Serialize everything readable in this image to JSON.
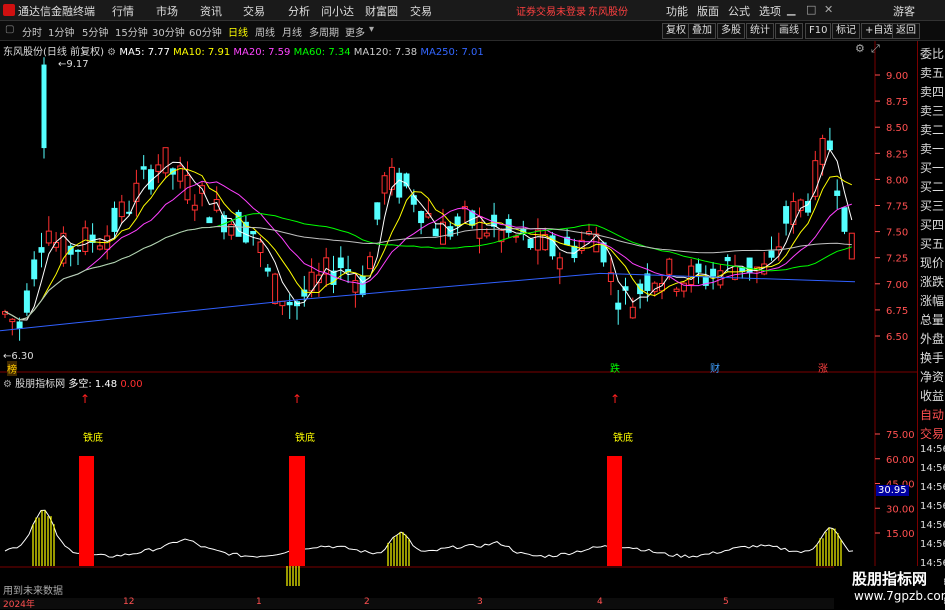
{
  "menubar": {
    "app_title": "通达信金融终端",
    "menus": [
      "行情",
      "市场",
      "资讯",
      "交易",
      "分析",
      "问小达",
      "财富圈",
      "交易"
    ],
    "notice": "证券交易未登录",
    "stock_short": "东风股份",
    "right_menus": [
      "功能",
      "版面",
      "公式",
      "选项"
    ],
    "user": "游客"
  },
  "periodbar": {
    "periods": [
      "分时",
      "1分钟",
      "5分钟",
      "15分钟",
      "30分钟",
      "60分钟",
      "日线",
      "周线",
      "月线",
      "多周期",
      "更多"
    ],
    "active": "日线",
    "right_buttons": [
      "复权",
      "叠加",
      "多股",
      "统计",
      "画线",
      "F10",
      "标记",
      "+自选",
      "返回"
    ]
  },
  "main_chart": {
    "title": "东风股份(日线 前复权)",
    "ma": [
      {
        "label": "MA5: 7.77",
        "color": "#ffffff"
      },
      {
        "label": "MA10: 7.91",
        "color": "#ffff00"
      },
      {
        "label": "MA20: 7.59",
        "color": "#ff40ff"
      },
      {
        "label": "MA60: 7.34",
        "color": "#00ff00"
      },
      {
        "label": "MA120: 7.38",
        "color": "#c0c0c0"
      },
      {
        "label": "MA250: 7.01",
        "color": "#3060ff"
      }
    ],
    "price_axis": [
      "9.00",
      "8.75",
      "8.50",
      "8.25",
      "8.00",
      "7.75",
      "7.50",
      "7.25",
      "7.00",
      "6.75",
      "6.50"
    ],
    "high_label": "9.17",
    "low_label": "6.30",
    "event_tags": [
      {
        "text": "榜",
        "color": "#ffcc00"
      },
      {
        "text": "跌",
        "color": "#00ff00"
      },
      {
        "text": "财",
        "color": "#40a0ff"
      },
      {
        "text": "涨",
        "color": "#ff4040"
      }
    ]
  },
  "indicator": {
    "name": "股朋指标网",
    "line_label": "多空: 1.48",
    "extra": "0.00",
    "axis": [
      "75.00",
      "60.00",
      "45.00",
      "30.00",
      "15.00"
    ],
    "current_value": "30.95",
    "signal_text": "铁底",
    "signal_arrow": "↑",
    "footer_note": "用到未来数据"
  },
  "sidebar": {
    "items": [
      "委比",
      "卖五",
      "卖四",
      "卖三",
      "卖二",
      "卖一",
      "买一",
      "买二",
      "买三",
      "买四",
      "买五",
      "现价",
      "涨跌",
      "涨幅",
      "总量",
      "外盘",
      "换手",
      "净资",
      "收益",
      "自动",
      "交易",
      "14:56",
      "14:56",
      "14:56",
      "14:56",
      "14:56",
      "14:56",
      "14:56",
      "14:56",
      "14:56"
    ]
  },
  "bottombar": {
    "ticks": [
      "2024年",
      "12",
      "1",
      "2",
      "3",
      "4",
      "5"
    ]
  },
  "watermark": {
    "line1": "股朋指标网",
    "line2": "www.7gpzb.com"
  },
  "colors": {
    "up": "#ff3030",
    "down": "#54ffff",
    "grid": "#7a0000"
  }
}
